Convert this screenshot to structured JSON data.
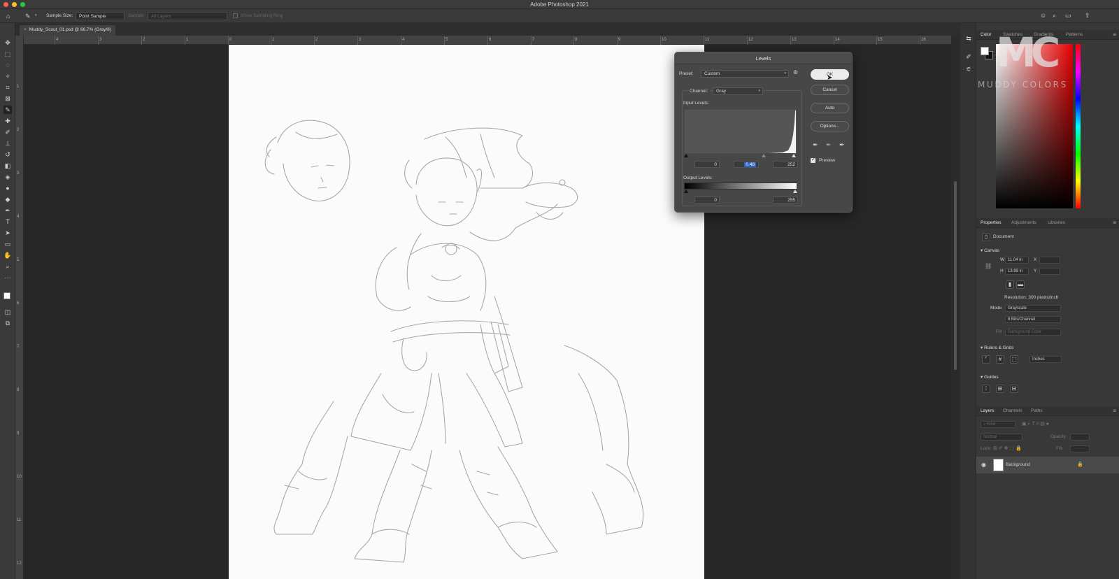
{
  "window": {
    "title": "Adobe Photoshop 2021",
    "traffic_colors": [
      "#ff5f57",
      "#febc2e",
      "#28c840"
    ]
  },
  "options_bar": {
    "sample_size_label": "Sample Size:",
    "sample_size_value": "Point Sample",
    "sample_label": "Sample:",
    "sample_value": "All Layers",
    "show_ring_label": "Show Sampling Ring"
  },
  "document": {
    "tab_title": "Muddy_Scout_01.psd @ 66.7% (Gray/8)"
  },
  "rulers": {
    "h_ticks": [
      "4",
      "3",
      "2",
      "1",
      "0",
      "1",
      "2",
      "3",
      "4",
      "5",
      "6",
      "7",
      "8",
      "9",
      "10",
      "11",
      "12",
      "13",
      "14",
      "15",
      "16"
    ],
    "v_ticks": [
      "1",
      "2",
      "3",
      "4",
      "5",
      "6",
      "7",
      "8",
      "9",
      "10",
      "11",
      "12"
    ]
  },
  "watermark": {
    "logo_letters": "MC",
    "logo_text": "MUDDY COLORS"
  },
  "color_panel": {
    "tabs": [
      "Color",
      "Swatches",
      "Gradients",
      "Patterns"
    ]
  },
  "properties_panel": {
    "tabs": [
      "Properties",
      "Adjustments",
      "Libraries"
    ],
    "doc_label": "Document",
    "canvas_section": "Canvas",
    "w_label": "W",
    "w_value": "11.04 in",
    "h_label": "H",
    "h_value": "13.99 in",
    "x_label": "X",
    "y_label": "Y",
    "resolution": "Resolution: 300 pixels/inch",
    "mode_label": "Mode",
    "mode_value": "Grayscale",
    "bits_value": "8 Bits/Channel",
    "fill_label": "Fill",
    "fill_value": "Background Color",
    "rulers_section": "Rulers & Grids",
    "units_value": "Inches",
    "guides_section": "Guides"
  },
  "layers_panel": {
    "tabs": [
      "Layers",
      "Channels",
      "Paths"
    ],
    "search_placeholder": "Kind",
    "blend_mode": "Normal",
    "opacity_label": "Opacity:",
    "lock_label": "Lock:",
    "fill_label": "Fill:",
    "layer_name": "Background"
  },
  "levels_dialog": {
    "title": "Levels",
    "preset_label": "Preset:",
    "preset_value": "Custom",
    "channel_label": "Channel:",
    "channel_value": "Gray",
    "input_levels_label": "Input Levels:",
    "input_black": "0",
    "input_gamma": "0.48",
    "input_white": "252",
    "output_levels_label": "Output Levels:",
    "output_black": "0",
    "output_white": "255",
    "ok_label": "OK",
    "cancel_label": "Cancel",
    "auto_label": "Auto",
    "options_label": "Options...",
    "preview_label": "Preview",
    "preview_checked": true
  }
}
